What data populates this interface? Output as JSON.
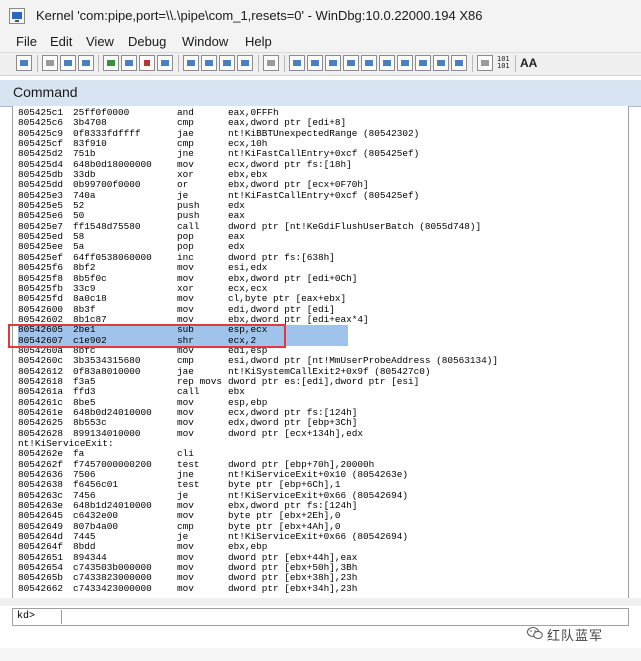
{
  "window": {
    "title": "Kernel 'com:pipe,port=\\\\.\\pipe\\com_1,resets=0' - WinDbg:10.0.22000.194 X86"
  },
  "menu": [
    "File",
    "Edit",
    "View",
    "Debug",
    "Window",
    "Help"
  ],
  "toolbar": {
    "icons": [
      "open-icon",
      "cut-icon",
      "copy-icon",
      "paste-icon",
      "go-icon",
      "restart-icon",
      "stop-icon",
      "break-icon",
      "step-into-icon",
      "step-over-icon",
      "step-out-icon",
      "run-to-cursor-icon",
      "hand-icon",
      "watch-icon",
      "locals-icon",
      "registers-icon",
      "memory-icon",
      "call-stack-icon",
      "disassembly-icon",
      "scratch-icon",
      "source-mode-icon",
      "hex-mode-icon",
      "font-icon"
    ],
    "hex_label_top": "101",
    "hex_label_bot": "101",
    "font_label": "AA"
  },
  "command": {
    "title": "Command",
    "prompt": "kd>",
    "input_value": "",
    "lines": [
      [
        "805425c1",
        "25ff0f0000",
        "and",
        "eax,0FFFh"
      ],
      [
        "805425c6",
        "3b4708",
        "cmp",
        "eax,dword ptr [edi+8]"
      ],
      [
        "805425c9",
        "0f8333fdffff",
        "jae",
        "nt!KiBBTUnexpectedRange (80542302)"
      ],
      [
        "805425cf",
        "83f910",
        "cmp",
        "ecx,10h"
      ],
      [
        "805425d2",
        "751b",
        "jne",
        "nt!KiFastCallEntry+0xcf (805425ef)"
      ],
      [
        "805425d4",
        "648b0d18000000",
        "mov",
        "ecx,dword ptr fs:[18h]"
      ],
      [
        "805425db",
        "33db",
        "xor",
        "ebx,ebx"
      ],
      [
        "805425dd",
        "0b99700f0000",
        "or",
        "ebx,dword ptr [ecx+0F70h]"
      ],
      [
        "805425e3",
        "740a",
        "je",
        "nt!KiFastCallEntry+0xcf (805425ef)"
      ],
      [
        "805425e5",
        "52",
        "push",
        "edx"
      ],
      [
        "805425e6",
        "50",
        "push",
        "eax"
      ],
      [
        "805425e7",
        "ff1548d75580",
        "call",
        "dword ptr [nt!KeGdiFlushUserBatch (8055d748)]"
      ],
      [
        "805425ed",
        "58",
        "pop",
        "eax"
      ],
      [
        "805425ee",
        "5a",
        "pop",
        "edx"
      ],
      [
        "805425ef",
        "64ff0538060000",
        "inc",
        "dword ptr fs:[638h]"
      ],
      [
        "805425f6",
        "8bf2",
        "mov",
        "esi,edx"
      ],
      [
        "805425f8",
        "8b5f0c",
        "mov",
        "ebx,dword ptr [edi+0Ch]"
      ],
      [
        "805425fb",
        "33c9",
        "xor",
        "ecx,ecx"
      ],
      [
        "805425fd",
        "8a0c18",
        "mov",
        "cl,byte ptr [eax+ebx]"
      ],
      [
        "80542600",
        "8b3f",
        "mov",
        "edi,dword ptr [edi]"
      ],
      [
        "80542602",
        "8b1c87",
        "mov",
        "ebx,dword ptr [edi+eax*4]"
      ],
      [
        "80542605",
        "2be1",
        "sub",
        "esp,ecx"
      ],
      [
        "80542607",
        "c1e902",
        "shr",
        "ecx,2"
      ],
      [
        "8054260a",
        "8bfc",
        "mov",
        "edi,esp"
      ],
      [
        "8054260c",
        "3b3534315680",
        "cmp",
        "esi,dword ptr [nt!MmUserProbeAddress (80563134)]"
      ],
      [
        "80542612",
        "0f83a8010000",
        "jae",
        "nt!KiSystemCallExit2+0x9f (805427c0)"
      ],
      [
        "80542618",
        "f3a5",
        "rep movs",
        "dword ptr es:[edi],dword ptr [esi]"
      ],
      [
        "8054261a",
        "ffd3",
        "call",
        "ebx"
      ],
      [
        "8054261c",
        "8be5",
        "mov",
        "esp,ebp"
      ],
      [
        "8054261e",
        "648b0d24010000",
        "mov",
        "ecx,dword ptr fs:[124h]"
      ],
      [
        "80542625",
        "8b553c",
        "mov",
        "edx,dword ptr [ebp+3Ch]"
      ],
      [
        "80542628",
        "899134010000",
        "mov",
        "dword ptr [ecx+134h],edx"
      ],
      [
        "nt!KiServiceExit:",
        "",
        "",
        ""
      ],
      [
        "8054262e",
        "fa",
        "cli",
        ""
      ],
      [
        "8054262f",
        "f7457000000200",
        "test",
        "dword ptr [ebp+70h],20000h"
      ],
      [
        "80542636",
        "7506",
        "jne",
        "nt!KiServiceExit+0x10 (8054263e)"
      ],
      [
        "80542638",
        "f6456c01",
        "test",
        "byte ptr [ebp+6Ch],1"
      ],
      [
        "8054263c",
        "7456",
        "je",
        "nt!KiServiceExit+0x66 (80542694)"
      ],
      [
        "8054263e",
        "648b1d24010000",
        "mov",
        "ebx,dword ptr fs:[124h]"
      ],
      [
        "80542645",
        "c6432e00",
        "mov",
        "byte ptr [ebx+2Eh],0"
      ],
      [
        "80542649",
        "807b4a00",
        "cmp",
        "byte ptr [ebx+4Ah],0"
      ],
      [
        "8054264d",
        "7445",
        "je",
        "nt!KiServiceExit+0x66 (80542694)"
      ],
      [
        "8054264f",
        "8bdd",
        "mov",
        "ebx,ebp"
      ],
      [
        "80542651",
        "894344",
        "mov",
        "dword ptr [ebx+44h],eax"
      ],
      [
        "80542654",
        "c743503b000000",
        "mov",
        "dword ptr [ebx+50h],3Bh"
      ],
      [
        "8054265b",
        "c7433823000000",
        "mov",
        "dword ptr [ebx+38h],23h"
      ],
      [
        "80542662",
        "c7433423000000",
        "mov",
        "dword ptr [ebx+34h],23h"
      ]
    ]
  },
  "watermark": {
    "text": "红队蓝军"
  }
}
